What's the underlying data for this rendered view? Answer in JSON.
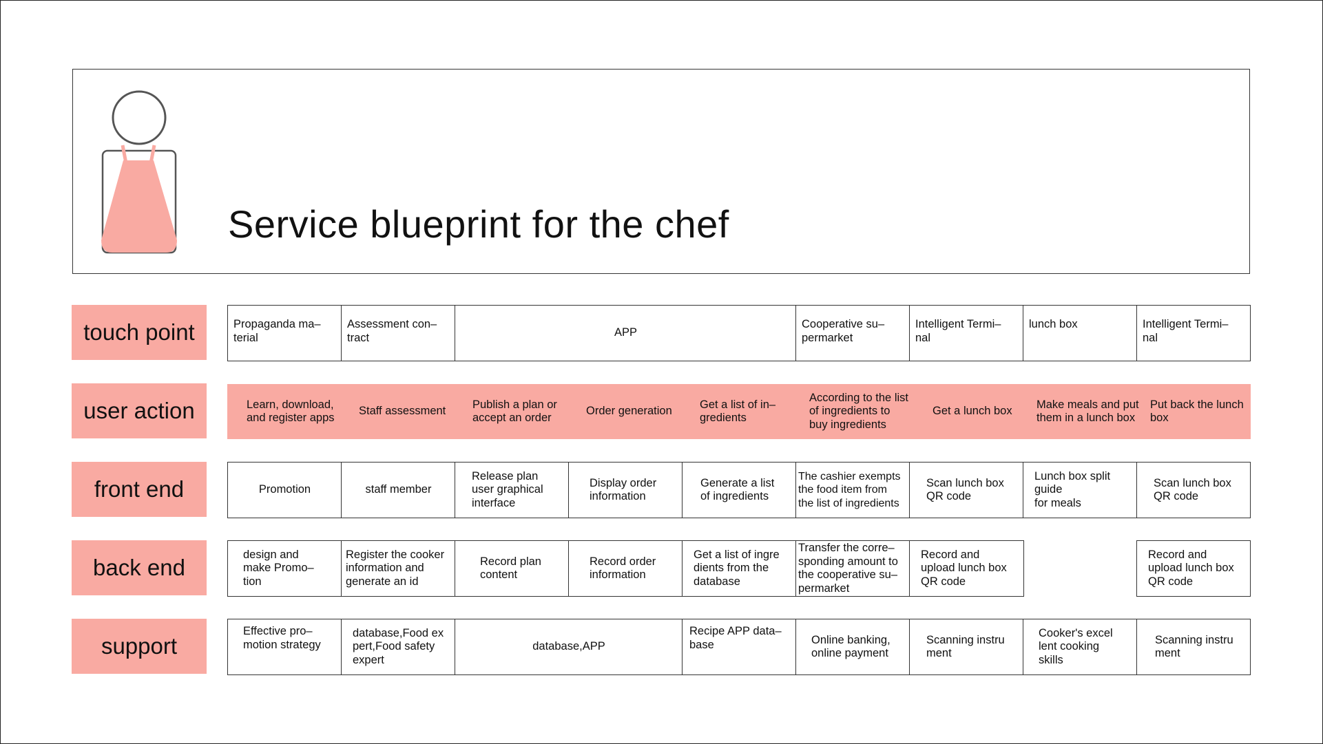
{
  "title": "Service blueprint for the chef",
  "colors": {
    "accent": "#f9aaa2",
    "border": "#333333"
  },
  "icon": "chef-apron-icon",
  "rows": {
    "touch_point": {
      "label": "touch point",
      "cells": [
        "Propaganda ma–\nterial",
        "Assessment con–\ntract",
        "APP",
        "Cooperative su–\npermarket",
        "Intelligent Termi–\nnal",
        "lunch box",
        "Intelligent Termi–\nnal"
      ]
    },
    "user_action": {
      "label": "user action",
      "cells": [
        "Learn, download,\nand register apps",
        "Staff assessment",
        "Publish a plan or\naccept an order",
        "Order generation",
        "Get a list of in–\ngredients",
        "According to the list\nof ingredients to\nbuy ingredients",
        "Get a lunch box",
        "Make meals and put\nthem in a lunch box",
        "Put back the lunch\nbox"
      ]
    },
    "front_end": {
      "label": "front end",
      "cells": [
        "Promotion",
        "staff member",
        "Release plan\nuser graphical\ninterface",
        "Display order\ninformation",
        "Generate a list\nof ingredients",
        "The cashier exempts\nthe food item from\nthe list of ingredients",
        "Scan lunch box\nQR code",
        "Lunch box split\nguide\nfor meals",
        "Scan lunch box\nQR code"
      ]
    },
    "back_end": {
      "label": "back end",
      "cells": [
        "design and\nmake Promo–\ntion",
        "Register the cooker\ninformation and\ngenerate an id",
        "Record plan\ncontent",
        "Record order\ninformation",
        "Get a list of ingre\ndients from the\ndatabase",
        "Transfer the corre–\nsponding amount to\nthe cooperative su–\npermarket",
        "Record and\nupload lunch box\nQR code",
        "Record and\nupload lunch box\nQR code"
      ]
    },
    "support": {
      "label": "support",
      "cells": [
        "Effective pro–\nmotion strategy",
        "database,Food ex\npert,Food safety\nexpert",
        "database,APP",
        "Recipe APP data–\nbase",
        "Online banking,\nonline payment",
        "Scanning instru\nment",
        "Cooker's excel\nlent cooking\nskills",
        "Scanning instru\nment"
      ]
    }
  }
}
